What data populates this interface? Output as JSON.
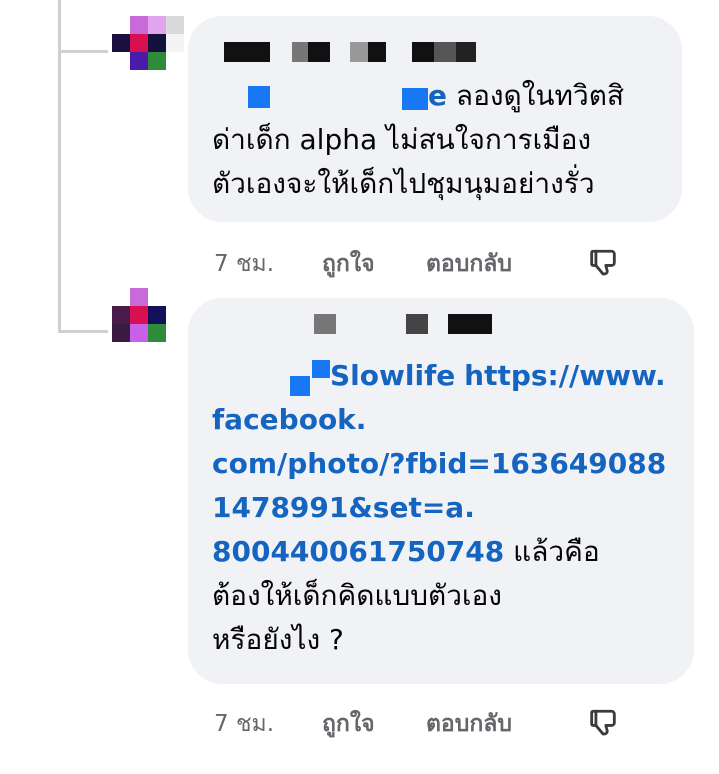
{
  "comments": [
    {
      "mention_suffix": "e",
      "text_line1": "ลองดูในทวิตสิ",
      "text_line2": "ด่าเด็ก alpha ไม่สนใจการเมือง",
      "text_line3": "ตัวเองจะให้เด็กไปชุมนุมอย่างรั่ว",
      "time": "7 ชม.",
      "like_label": "ถูกใจ",
      "reply_label": "ตอบกลับ",
      "dislike_icon": "thumbs-down-icon"
    },
    {
      "mention": "Slowlife",
      "link_line1": "https://www.",
      "link_line2": "facebook.",
      "link_line3": "com/photo/?fbid=163649088",
      "link_line4": "1478991&set=a.",
      "link_line5": "800440061750748",
      "text_after_link": "แล้วคือ",
      "text_line2": "ต้องให้เด็กคิดแบบตัวเอง",
      "text_line3": "หรือยังไง ?",
      "time": "7 ชม.",
      "like_label": "ถูกใจ",
      "reply_label": "ตอบกลับ",
      "dislike_icon": "thumbs-down-icon"
    }
  ],
  "colors": {
    "bubble": "#f0f2f5",
    "link": "#1565c0",
    "meta_text": "#65676b",
    "thread_line": "#ced0d4"
  }
}
